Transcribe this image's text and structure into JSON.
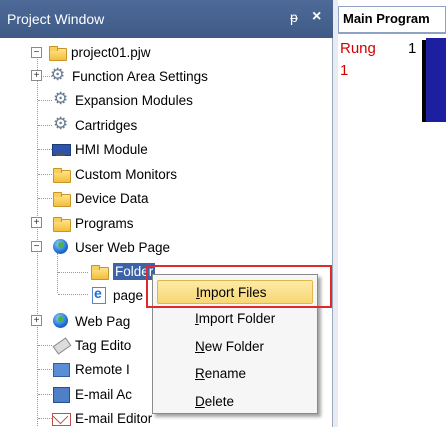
{
  "project_window": {
    "title": "Project Window",
    "pin_glyph": "ᵖ",
    "close_glyph": "×"
  },
  "tree": {
    "root": "project01.pjw",
    "items": [
      {
        "label": "Function Area Settings",
        "icon": "gear-icon"
      },
      {
        "label": "Expansion Modules",
        "icon": "gear-icon"
      },
      {
        "label": "Cartridges",
        "icon": "gear-icon"
      },
      {
        "label": "HMI Module",
        "icon": "monitor-icon"
      },
      {
        "label": "Custom Monitors",
        "icon": "folder-icon"
      },
      {
        "label": "Device Data",
        "icon": "folder-icon"
      },
      {
        "label": "Programs",
        "icon": "folder-icon"
      },
      {
        "label": "User Web Page",
        "icon": "globe-icon"
      },
      {
        "label": "Folder",
        "icon": "folder-icon"
      },
      {
        "label": "page",
        "icon": "page-icon"
      },
      {
        "label": "Web Pag",
        "icon": "globe-icon"
      },
      {
        "label": "Tag Edito",
        "icon": "tag-icon"
      },
      {
        "label": "Remote I",
        "icon": "remote-icon"
      },
      {
        "label": "E-mail Ac",
        "icon": "book-icon"
      },
      {
        "label": "E-mail Editor",
        "icon": "mail-icon"
      }
    ]
  },
  "editor": {
    "tab_label": "Main Program",
    "rung_label": "Rung",
    "rung_number": "1",
    "rung_sub": "1"
  },
  "context_menu": {
    "items": [
      {
        "accel": "I",
        "rest": "mport Files"
      },
      {
        "accel": "I",
        "rest": "mport Folder"
      },
      {
        "accel": "N",
        "rest": "ew Folder"
      },
      {
        "accel": "R",
        "rest": "ename"
      },
      {
        "accel": "D",
        "rest": "elete"
      }
    ]
  },
  "colors": {
    "titlebar": "#4d6a98",
    "highlight_box": "#e02a2a",
    "rung_text": "#d40000",
    "rung_block": "#1b1fa0"
  }
}
